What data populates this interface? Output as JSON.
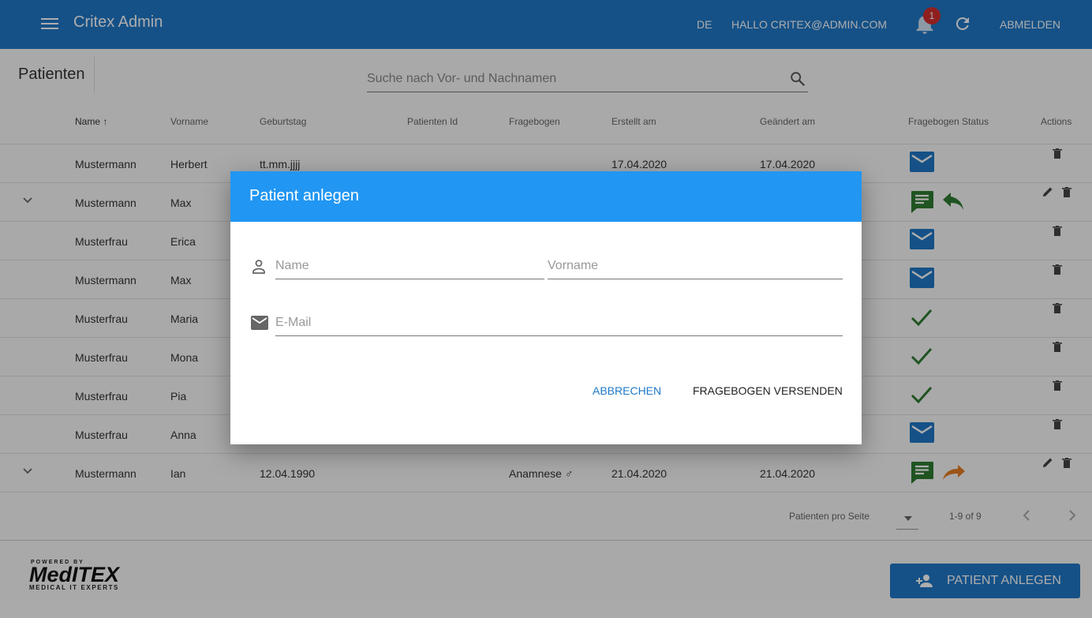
{
  "appbar": {
    "title": "Critex Admin",
    "lang": "DE",
    "greeting": "HALLO CRITEX@ADMIN.COM",
    "notification_count": "1",
    "logout_label": "ABMELDEN"
  },
  "page": {
    "title": "Patienten",
    "search_placeholder": "Suche nach Vor- und Nachnamen"
  },
  "table": {
    "columns": [
      "Name",
      "Vorname",
      "Geburtstag",
      "Patienten Id",
      "Fragebogen",
      "Erstellt am",
      "Geändert am",
      "Fragebogen Status",
      "Actions"
    ],
    "rows": [
      {
        "name": "Mustermann",
        "vorname": "Herbert",
        "geburtstag": "tt.mm.jjjj",
        "fragebogen": "",
        "erstellt": "17.04.2020",
        "geaendert": "17.04.2020",
        "status": "mail-icon",
        "expandable": false,
        "editable": false
      },
      {
        "name": "Mustermann",
        "vorname": "Max",
        "geburtstag": "",
        "fragebogen": "",
        "erstellt": "",
        "geaendert": "",
        "status": "comment-icon",
        "status2": "reply-icon",
        "expandable": true,
        "editable": true
      },
      {
        "name": "Musterfrau",
        "vorname": "Erica",
        "geburtstag": "",
        "fragebogen": "",
        "erstellt": "",
        "geaendert": "",
        "status": "mail-icon",
        "expandable": false,
        "editable": false
      },
      {
        "name": "Mustermann",
        "vorname": "Max",
        "geburtstag": "",
        "fragebogen": "",
        "erstellt": "",
        "geaendert": "",
        "status": "mail-icon",
        "expandable": false,
        "editable": false
      },
      {
        "name": "Musterfrau",
        "vorname": "Maria",
        "geburtstag": "",
        "fragebogen": "",
        "erstellt": "",
        "geaendert": "",
        "status": "check-icon",
        "expandable": false,
        "editable": false
      },
      {
        "name": "Musterfrau",
        "vorname": "Mona",
        "geburtstag": "",
        "fragebogen": "",
        "erstellt": "",
        "geaendert": "",
        "status": "check-icon",
        "expandable": false,
        "editable": false
      },
      {
        "name": "Musterfrau",
        "vorname": "Pia",
        "geburtstag": "",
        "fragebogen": "",
        "erstellt": "",
        "geaendert": "",
        "status": "check-icon",
        "expandable": false,
        "editable": false
      },
      {
        "name": "Musterfrau",
        "vorname": "Anna",
        "geburtstag": "",
        "fragebogen": "",
        "erstellt": "",
        "geaendert": "",
        "status": "mail-icon",
        "expandable": false,
        "editable": false
      },
      {
        "name": "Mustermann",
        "vorname": "Ian",
        "geburtstag": "12.04.1990",
        "fragebogen": "Anamnese ♂",
        "erstellt": "21.04.2020",
        "geaendert": "21.04.2020",
        "status": "comment-icon",
        "status2": "forward-icon",
        "expandable": true,
        "editable": true
      }
    ]
  },
  "pager": {
    "per_page_label": "Patienten pro Seite",
    "range": "1-9 of 9"
  },
  "logo": {
    "powered": "POWERED BY",
    "brand": "MedITEX",
    "tagline": "MEDICAL IT EXPERTS"
  },
  "fab": {
    "label": "PATIENT ANLEGEN"
  },
  "dialog": {
    "title": "Patient anlegen",
    "name_placeholder": "Name",
    "vorname_placeholder": "Vorname",
    "email_placeholder": "E-Mail",
    "cancel_label": "ABBRECHEN",
    "send_label": "FRAGEBOGEN VERSENDEN"
  },
  "colors": {
    "primary": "#1f78c8",
    "dialog_header": "#2196f3",
    "status_green": "#2e7d32",
    "status_orange": "#e67e22"
  }
}
